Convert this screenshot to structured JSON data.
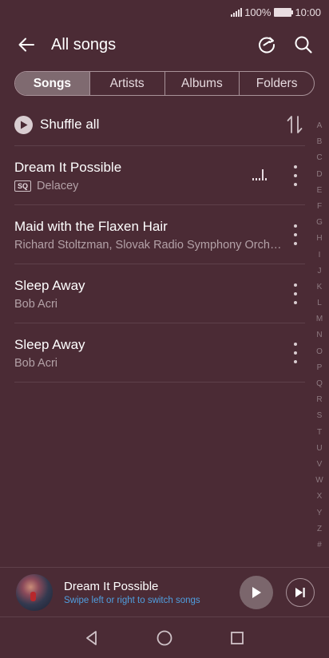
{
  "status_bar": {
    "battery": "100%",
    "time": "10:00"
  },
  "header": {
    "title": "All songs",
    "back_icon": "arrow-left-icon",
    "refresh_icon": "refresh-icon",
    "search_icon": "search-icon"
  },
  "tabs": [
    {
      "label": "Songs",
      "active": true
    },
    {
      "label": "Artists",
      "active": false
    },
    {
      "label": "Albums",
      "active": false
    },
    {
      "label": "Folders",
      "active": false
    }
  ],
  "shuffle": {
    "label": "Shuffle all"
  },
  "songs": [
    {
      "title": "Dream It Possible",
      "artist": "Delacey",
      "badge": "SQ",
      "playing": true
    },
    {
      "title": "Maid with the Flaxen Hair",
      "artist": "Richard Stoltzman, Slovak Radio Symphony Orche…",
      "badge": "",
      "playing": false
    },
    {
      "title": "Sleep Away",
      "artist": "Bob Acri",
      "badge": "",
      "playing": false
    },
    {
      "title": "Sleep Away",
      "artist": "Bob Acri",
      "badge": "",
      "playing": false
    }
  ],
  "alphabet": [
    "A",
    "B",
    "C",
    "D",
    "E",
    "F",
    "G",
    "H",
    "I",
    "J",
    "K",
    "L",
    "M",
    "N",
    "O",
    "P",
    "Q",
    "R",
    "S",
    "T",
    "U",
    "V",
    "W",
    "X",
    "Y",
    "Z",
    "#"
  ],
  "now_playing": {
    "title": "Dream It Possible",
    "hint": "Swipe left or right to switch songs"
  },
  "colors": {
    "background": "#4b2b35",
    "accent_hint": "#4f9fe0",
    "secondary_text": "#b3a1a7"
  }
}
